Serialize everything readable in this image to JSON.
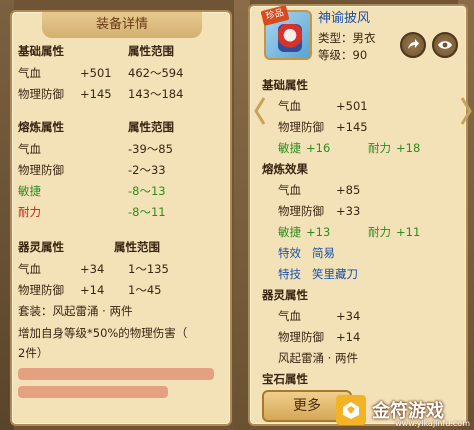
{
  "left_panel": {
    "title": "装备详情",
    "base": {
      "header_name": "基础属性",
      "header_range": "属性范围",
      "rows": [
        {
          "name": "气血",
          "value": "+501",
          "range": "462～594"
        },
        {
          "name": "物理防御",
          "value": "+145",
          "range": "143～184"
        }
      ]
    },
    "refine": {
      "header_name": "熔炼属性",
      "header_range": "属性范围",
      "rows": [
        {
          "name": "气血",
          "range": "-39～85"
        },
        {
          "name": "物理防御",
          "range": "-2～33"
        },
        {
          "name": "敏捷",
          "range": "-8～13"
        },
        {
          "name": "耐力",
          "range": "-8～11"
        }
      ]
    },
    "spirit": {
      "header_name": "器灵属性",
      "header_range": "属性范围",
      "rows": [
        {
          "name": "气血",
          "value": "+34",
          "range": "1～135"
        },
        {
          "name": "物理防御",
          "value": "+14",
          "range": "1～45"
        }
      ]
    },
    "set_line": "套装：风起雷涌 · 两件",
    "bonus_line1": "增加自身等级*50%的物理伤害（",
    "bonus_line2": "2件）"
  },
  "right_panel": {
    "item_name": "神谕披风",
    "item_tag": "珍品",
    "type_line": "类型：男衣",
    "level_line": "等级：90",
    "base_header": "基础属性",
    "base_rows": [
      {
        "name": "气血",
        "value": "+501"
      },
      {
        "name": "物理防御",
        "value": "+145"
      }
    ],
    "base_extra": [
      {
        "name": "敏捷",
        "value": "+16"
      },
      {
        "name": "耐力",
        "value": "+18"
      }
    ],
    "refine_header": "熔炼效果",
    "refine_rows": [
      {
        "name": "气血",
        "value": "+85"
      },
      {
        "name": "物理防御",
        "value": "+33"
      }
    ],
    "refine_extra": [
      {
        "name": "敏捷",
        "value": "+13"
      },
      {
        "name": "耐力",
        "value": "+11"
      }
    ],
    "skill_rows": [
      {
        "name": "特效",
        "value": "简易"
      },
      {
        "name": "特技",
        "value": "笑里藏刀"
      }
    ],
    "spirit_header": "器灵属性",
    "spirit_rows": [
      {
        "name": "气血",
        "value": "+34"
      },
      {
        "name": "物理防御",
        "value": "+14"
      }
    ],
    "spirit_set": "风起雷涌 · 两件",
    "gem_header": "宝石属性",
    "more_button": "更多"
  },
  "watermark": {
    "text": "金符游戏",
    "url": "www.yikajinfu.com"
  },
  "colors": {
    "panel_bg": "#f3e2b8",
    "green_text": "#2f8a1e",
    "red_text": "#c0261a"
  }
}
